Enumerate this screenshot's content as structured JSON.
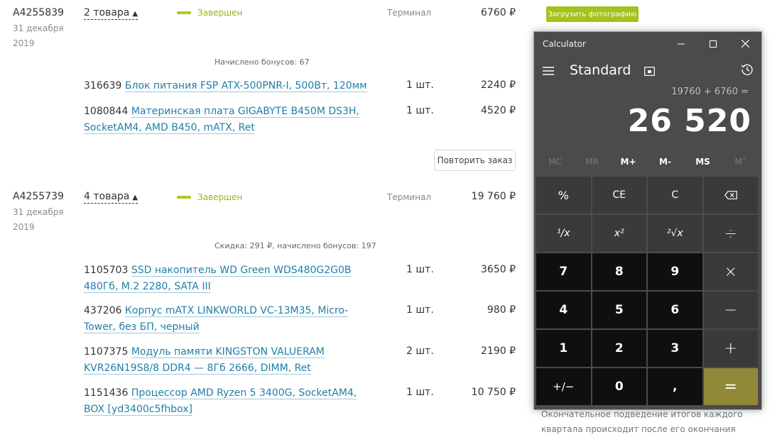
{
  "orders": [
    {
      "id": "A4255839",
      "date_day": "31 декабря",
      "date_year": "2019",
      "goods_count_label": "2 товара",
      "status": "Завершен",
      "delivery": "Терминал",
      "total": "6760 ₽",
      "note": "Начислено бонусов: 67",
      "items": [
        {
          "code": "316639",
          "name": "Блок питания FSP ATX-500PNR-I, 500Вт, 120мм",
          "qty": "1 шт.",
          "price": "2240 ₽"
        },
        {
          "code": "1080844",
          "name_line1": "Материнская плата GIGABYTE B450M DS3H,",
          "name_line2": "SocketAM4, AMD B450, mATX, Ret",
          "qty": "1 шт.",
          "price": "4520 ₽"
        }
      ],
      "repeat_label": "Повторить заказ"
    },
    {
      "id": "A4255739",
      "date_day": "31 декабря",
      "date_year": "2019",
      "goods_count_label": "4 товара",
      "status": "Завершен",
      "delivery": "Терминал",
      "total": "19 760 ₽",
      "note": "Скидка: 291 ₽, начислено бонусов: 197",
      "items": [
        {
          "code": "1105703",
          "name_line1": "SSD накопитель WD Green WDS480G2G0B",
          "name_line2": "480Гб, M.2 2280, SATA III",
          "qty": "1 шт.",
          "price": "3650 ₽"
        },
        {
          "code": "437206",
          "name_line1": "Корпус mATX LINKWORLD VC-13M35, Micro-",
          "name_line2": "Tower, без БП, черный",
          "qty": "1 шт.",
          "price": "980 ₽"
        },
        {
          "code": "1107375",
          "name_line1": "Модуль памяти KINGSTON VALUERAM",
          "name_line2": "KVR26N19S8/8 DDR4 — 8Гб 2666, DIMM, Ret",
          "qty": "2 шт.",
          "price": "2190 ₽"
        },
        {
          "code": "1151436",
          "name_line1": "Процессор AMD Ryzen 5 3400G, SocketAM4,",
          "name_line2": "BOX [yd3400c5fhbox]",
          "qty": "1 шт.",
          "price": "10 750 ₽"
        }
      ]
    }
  ],
  "upload_photo_label": "Загрузить фотографию",
  "footer_text_line1": "Окончательное подведение итогов каждого",
  "footer_text_line2": "квартала происходит после его окончания",
  "calculator": {
    "window_title": "Calculator",
    "mode": "Standard",
    "expression": "19760 + 6760 =",
    "display": "26 520",
    "memory_buttons": [
      "MC",
      "MR",
      "M+",
      "M-",
      "MS",
      "M˅"
    ],
    "keys": {
      "percent": "%",
      "ce": "CE",
      "c": "C",
      "reciprocal": "¹/x",
      "square": "x²",
      "sqrt": "²√x",
      "divide": "÷",
      "multiply": "×",
      "minus": "−",
      "plus": "+",
      "seven": "7",
      "eight": "8",
      "nine": "9",
      "four": "4",
      "five": "5",
      "six": "6",
      "one": "1",
      "two": "2",
      "three": "3",
      "negate": "+/−",
      "zero": "0",
      "decimal": ",",
      "equals": "="
    },
    "accent_color": "#908a38"
  }
}
